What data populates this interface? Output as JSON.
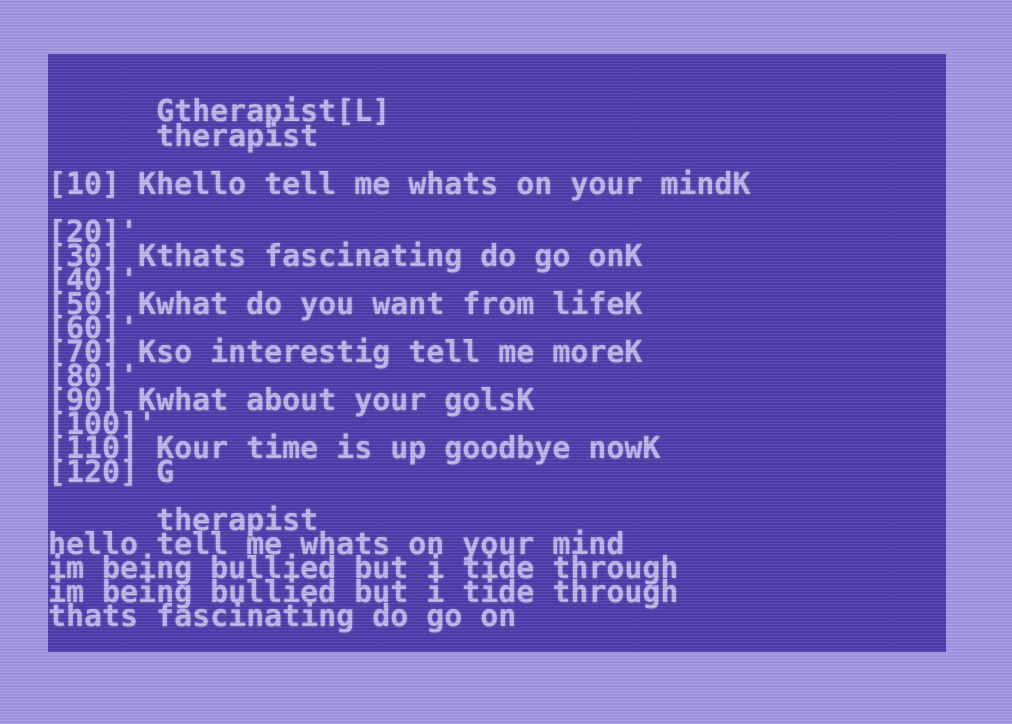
{
  "listing": {
    "header_line_1": "      Gtherapist[L]",
    "header_line_2": "      therapist",
    "line_10": "[10] Khello tell me whats on your mindK",
    "line_20": "[20]'",
    "line_30": "[30] Kthats fascinating do go onK",
    "line_40": "[40]'",
    "line_50": "[50] Kwhat do you want from lifeK",
    "line_60": "[60]'",
    "line_70": "[70] Kso interestig tell me moreK",
    "line_80": "[80]'",
    "line_90": "[90] Kwhat about your golsK",
    "line_100": "[100]'",
    "line_110": "[110] Kour time is up goodbye nowK",
    "line_120": "[120] G"
  },
  "output": {
    "title": "      therapist",
    "line_1": "hello tell me whats on your mind",
    "line_2": "im being bullied but i tide through",
    "line_3": "im being bullied but i tide through",
    "line_4": "thats fascinating do go on"
  }
}
